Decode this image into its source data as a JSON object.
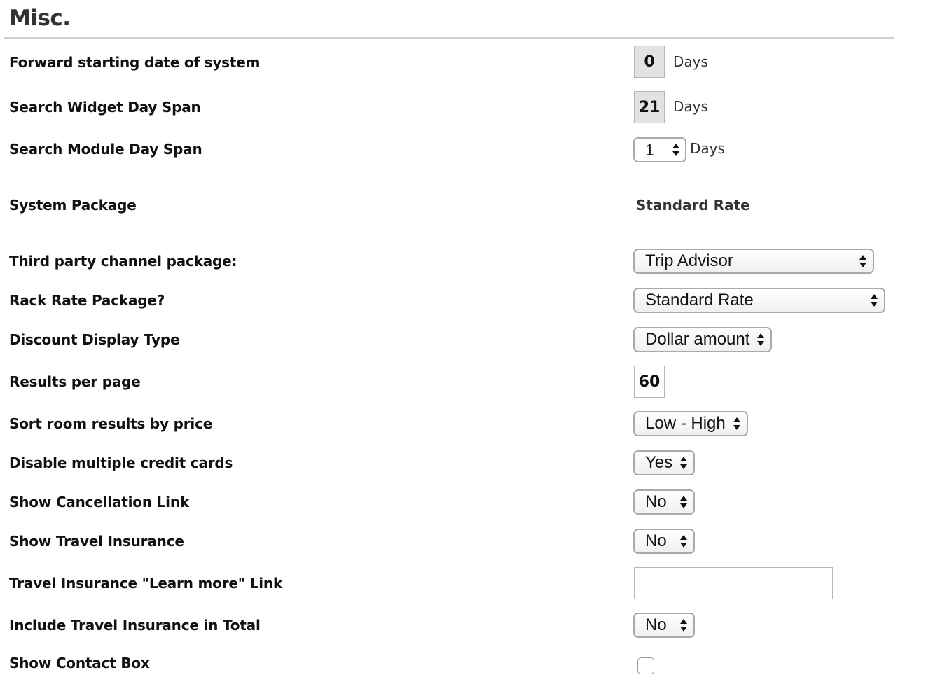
{
  "section": {
    "title": "Misc."
  },
  "rows": {
    "forward_start": {
      "label": "Forward starting date of system",
      "value": "0",
      "unit": "Days"
    },
    "widget_span": {
      "label": "Search Widget Day Span",
      "value": "21",
      "unit": "Days"
    },
    "module_span": {
      "label": "Search Module Day Span",
      "value": "1",
      "unit": "Days"
    },
    "system_package": {
      "label": "System Package",
      "value": "Standard Rate"
    },
    "third_party": {
      "label": "Third party channel package:",
      "value": "Trip Advisor"
    },
    "rack_rate": {
      "label": "Rack Rate Package?",
      "value": "Standard Rate"
    },
    "discount_type": {
      "label": "Discount Display Type",
      "value": "Dollar amount"
    },
    "results_per_page": {
      "label": "Results per page",
      "value": "60"
    },
    "sort_price": {
      "label": "Sort room results by price",
      "value": "Low - High"
    },
    "disable_multi_cc": {
      "label": "Disable multiple credit cards",
      "value": "Yes"
    },
    "show_cancel_link": {
      "label": "Show Cancellation Link",
      "value": "No"
    },
    "show_travel_ins": {
      "label": "Show Travel Insurance",
      "value": "No"
    },
    "travel_ins_link": {
      "label": "Travel Insurance \"Learn more\" Link",
      "value": ""
    },
    "include_travel_ins": {
      "label": "Include Travel Insurance in Total",
      "value": "No"
    },
    "show_contact_box": {
      "label": "Show Contact Box",
      "checked": false
    }
  }
}
